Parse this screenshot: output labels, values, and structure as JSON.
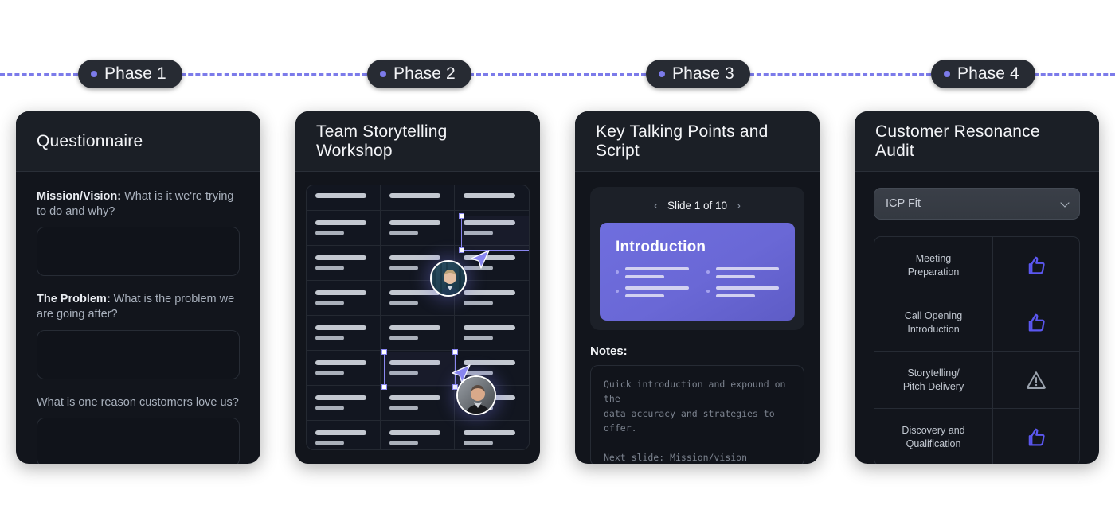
{
  "timeline": {
    "phases": [
      {
        "label": "Phase 1",
        "dot_color": "#7c7bea"
      },
      {
        "label": "Phase 2",
        "dot_color": "#7c7bea"
      },
      {
        "label": "Phase 3",
        "dot_color": "#7c7bea"
      },
      {
        "label": "Phase 4",
        "dot_color": "#7c7bea"
      }
    ],
    "line_color": "#7c7bea",
    "line_style": "dashed"
  },
  "cards": {
    "questionnaire": {
      "title": "Questionnaire",
      "questions": [
        {
          "bold": "Mission/Vision:",
          "rest": " What is it we're trying to do and why?",
          "answer": ""
        },
        {
          "bold": "The Problem:",
          "rest": " What is the problem we are going after?",
          "answer": ""
        },
        {
          "bold": "",
          "rest": "What is one reason customers love us?",
          "answer": ""
        }
      ]
    },
    "workshop": {
      "title": "Team Storytelling Workshop",
      "grid": {
        "rows": 8,
        "columns": 3
      },
      "selections": [
        {
          "name": "selection-top",
          "row": 2,
          "column": 3
        },
        {
          "name": "selection-bottom",
          "row": 6,
          "column": 2
        }
      ],
      "collaborators": [
        {
          "name": "collaborator-one"
        },
        {
          "name": "collaborator-two"
        }
      ]
    },
    "script": {
      "title": "Key Talking Points and Script",
      "slide_nav": {
        "prev": "‹",
        "next": "›",
        "counter": "Slide 1 of 10",
        "current": 1,
        "total": 10
      },
      "slide": {
        "title": "Introduction",
        "accent": "#6f6ede",
        "bullet_columns": 2,
        "bullets_per_column": 2
      },
      "notes_label": "Notes:",
      "notes_text": "Quick introduction and expound on the\ndata accuracy and strategies to offer.\n\nNext slide: Mission/vision"
    },
    "audit": {
      "title": "Customer Resonance Audit",
      "filter": {
        "value": "ICP Fit",
        "caret": "chevron-down"
      },
      "rows": [
        {
          "label": "Meeting\nPreparation",
          "status": "thumbs-up",
          "status_color": "#5b57f0"
        },
        {
          "label": "Call Opening\nIntroduction",
          "status": "thumbs-up",
          "status_color": "#5b57f0"
        },
        {
          "label": "Storytelling/\nPitch Delivery",
          "status": "warning",
          "status_color": "#9aa2ad"
        },
        {
          "label": "Discovery and\nQualification",
          "status": "thumbs-up",
          "status_color": "#5b57f0"
        }
      ]
    }
  }
}
